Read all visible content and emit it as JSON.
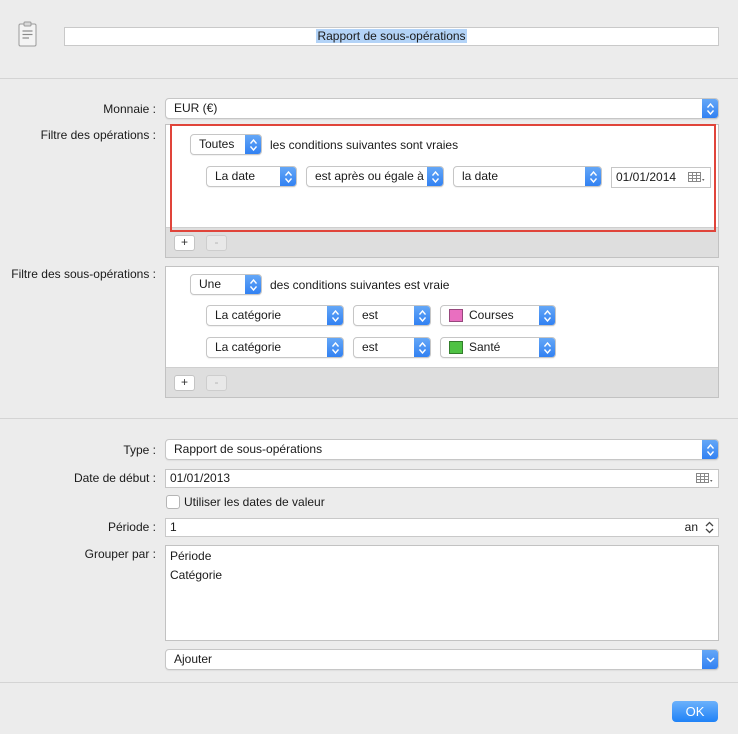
{
  "header": {
    "report_name": "Rapport de sous-opérations"
  },
  "currency": {
    "label": "Monnaie :",
    "value": "EUR (€)"
  },
  "operation_filter": {
    "label": "Filtre des opérations :",
    "match_mode": "Toutes",
    "match_text": "les conditions suivantes sont vraies",
    "conditions": [
      {
        "field": "La date",
        "operator": "est après ou égale à",
        "value_type": "la date",
        "date": "01/01/2014"
      }
    ],
    "add_button": "+",
    "remove_button": "-"
  },
  "suboperation_filter": {
    "label": "Filtre des sous-opérations :",
    "match_mode": "Une",
    "match_text": "des conditions suivantes est vraie",
    "conditions": [
      {
        "field": "La catégorie",
        "operator": "est",
        "value": "Courses",
        "color": "#e96fc0"
      },
      {
        "field": "La catégorie",
        "operator": "est",
        "value": "Santé",
        "color": "#4fc244"
      }
    ],
    "add_button": "+",
    "remove_button": "-"
  },
  "type": {
    "label": "Type :",
    "value": "Rapport de sous-opérations"
  },
  "start_date": {
    "label": "Date de début :",
    "value": "01/01/2013"
  },
  "value_dates": {
    "label": "Utiliser les dates de valeur",
    "checked": false
  },
  "period": {
    "label": "Période :",
    "value": "1",
    "unit": "an"
  },
  "group_by": {
    "label": "Grouper par :",
    "items": [
      "Période",
      "Catégorie"
    ]
  },
  "add_popup": {
    "value": "Ajouter"
  },
  "ok_button": "OK",
  "colors": {
    "accent": "#2f7ff2",
    "highlight_frame": "#e0443a",
    "selection": "#b3d3f7"
  }
}
